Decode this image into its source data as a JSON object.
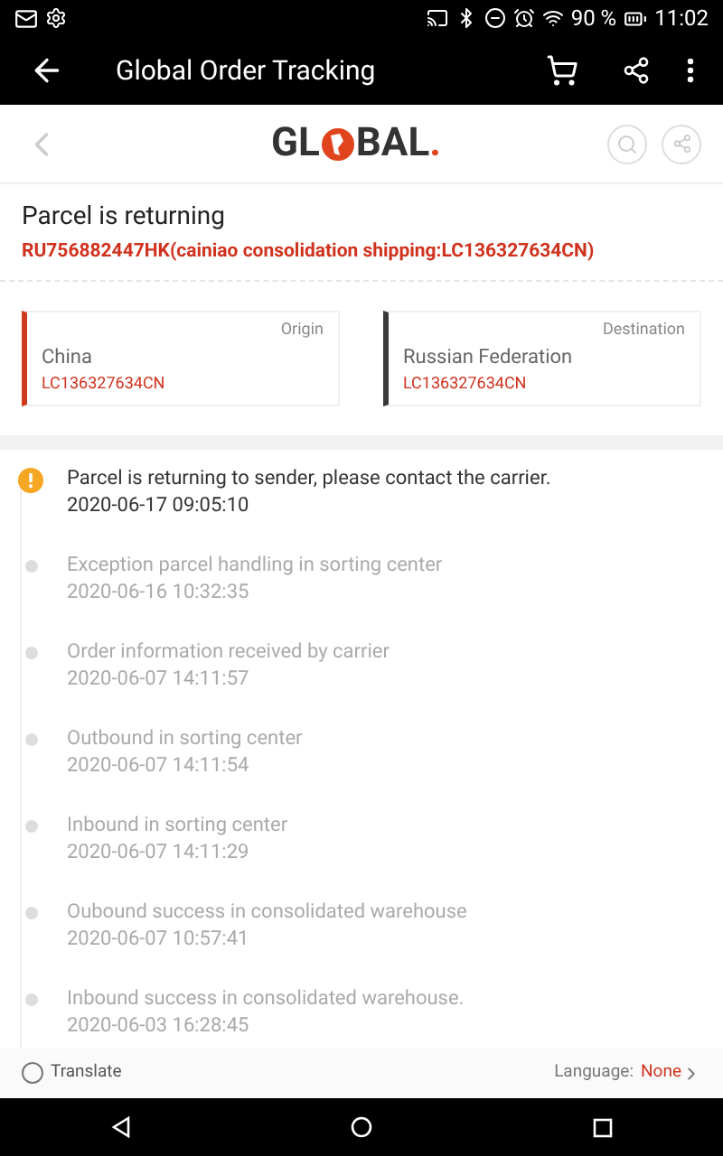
{
  "status_bar": {
    "battery": "90 %",
    "time": "11:02"
  },
  "app_bar": {
    "title": "Global Order Tracking"
  },
  "logo": {
    "left": "GL",
    "right": "BAL",
    "dot": "."
  },
  "parcel": {
    "title": "Parcel is returning",
    "tracking": "RU756882447HK(cainiao consolidation shipping:LC136327634CN)"
  },
  "route": [
    {
      "label": "Origin",
      "country": "China",
      "code": "LC136327634CN",
      "color": "#d03a1c"
    },
    {
      "label": "Destination",
      "country": "Russian Federation",
      "code": "LC136327634CN",
      "color": "#3a3a3a"
    }
  ],
  "events": [
    {
      "kind": "alert",
      "text": "Parcel is returning to sender, please contact the carrier.",
      "time": "2020-06-17 09:05:10"
    },
    {
      "kind": "normal",
      "text": "Exception parcel handling in sorting center",
      "time": "2020-06-16 10:32:35"
    },
    {
      "kind": "normal",
      "text": "Order information received by carrier",
      "time": "2020-06-07 14:11:57"
    },
    {
      "kind": "normal",
      "text": "Outbound in sorting center",
      "time": "2020-06-07 14:11:54"
    },
    {
      "kind": "normal",
      "text": "Inbound in sorting center",
      "time": "2020-06-07 14:11:29"
    },
    {
      "kind": "normal",
      "text": "Oubound success in consolidated warehouse",
      "time": "2020-06-07 10:57:41"
    },
    {
      "kind": "normal",
      "text": "Inbound success in consolidated warehouse.",
      "time": "2020-06-03 16:28:45"
    }
  ],
  "translate": {
    "label": "Translate",
    "checked": false,
    "language_label": "Language:",
    "language": "None"
  }
}
